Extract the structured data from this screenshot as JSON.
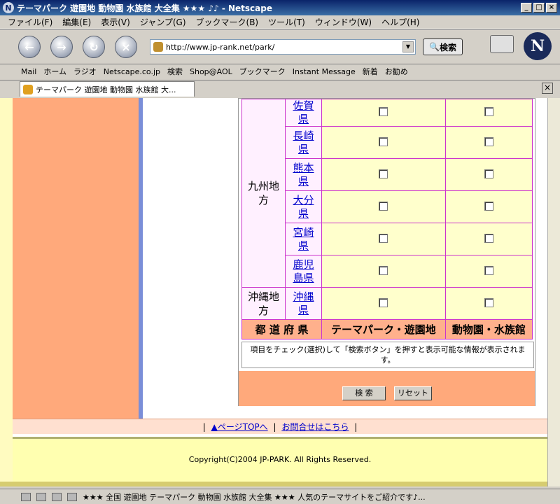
{
  "window": {
    "title": "テーマパーク 遊園地 動物園 水族館 大全集 ★★★ ♪♪ - Netscape",
    "controls": [
      "_",
      "□",
      "×"
    ]
  },
  "menu": [
    "ファイル(F)",
    "編集(E)",
    "表示(V)",
    "ジャンプ(G)",
    "ブックマーク(B)",
    "ツール(T)",
    "ウィンドウ(W)",
    "ヘルプ(H)"
  ],
  "toolbar": {
    "url": "http://www.jp-rank.net/park/",
    "search_label": "検索"
  },
  "bookmarks": [
    "Mail",
    "ホーム",
    "ラジオ",
    "Netscape.co.jp",
    "検索",
    "Shop@AOL",
    "ブックマーク",
    "Instant Message",
    "新着",
    "お勧め"
  ],
  "tab": {
    "title": "テーマパーク 遊園地 動物園 水族館 大..."
  },
  "table": {
    "region_kyushu": "九州地方",
    "region_okinawa": "沖縄地方",
    "prefectures": [
      "佐賀県",
      "長崎県",
      "熊本県",
      "大分県",
      "宮崎県",
      "鹿児島県",
      "沖縄県"
    ],
    "header": {
      "pref": "都 道 府 県",
      "park": "テーマパーク・遊園地",
      "zoo": "動物園・水族館"
    }
  },
  "note": "項目をチェック(選択)して「検索ボタン」を押すと表示可能な情報が表示されます。",
  "buttons": {
    "search": "検 索",
    "reset": "リセット"
  },
  "footer": {
    "sep": "|",
    "top_link": "▲ページTOPへ",
    "contact_link": "お問合せはこちら",
    "copyright": "Copyright(C)2004 JP-PARK. All Rights Reserved."
  },
  "status": {
    "text": "★★★ 全国 遊園地 テーマパーク 動物園 水族館 大全集 ★★★ 人気のテーマサイトをご紹介です♪..."
  }
}
